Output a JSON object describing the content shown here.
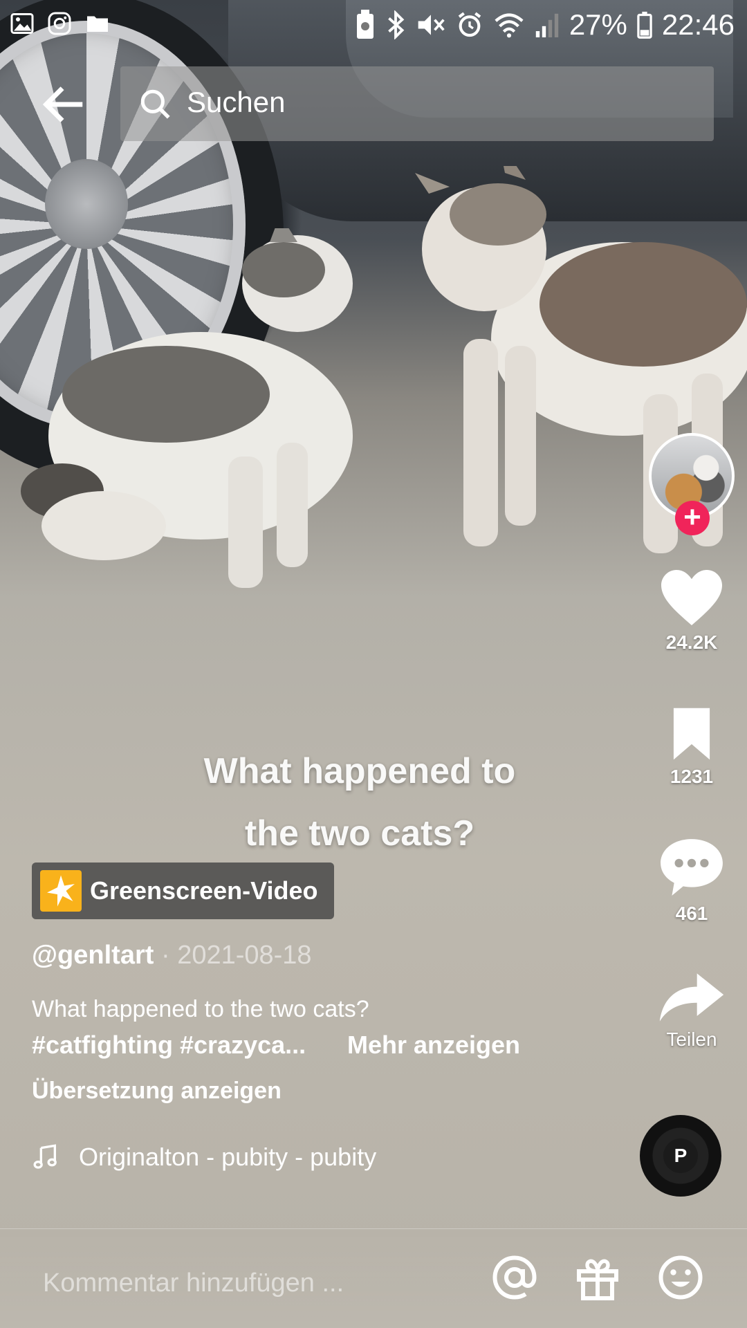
{
  "status_bar": {
    "battery_percent": "27%",
    "time": "22:46",
    "left_icons": [
      "gallery-icon",
      "instagram-icon",
      "folder-icon"
    ],
    "right_icons": [
      "battery-saver-icon",
      "bluetooth-icon",
      "mute-icon",
      "alarm-icon",
      "wifi-icon",
      "signal-icon",
      "battery-icon"
    ]
  },
  "header": {
    "search_placeholder": "Suchen"
  },
  "video": {
    "overlay_caption_line1": "What happened to",
    "overlay_caption_line2": "the two cats?",
    "effect_label": "Greenscreen-Video",
    "author": "@genltart",
    "date": "2021-08-18",
    "description": "What happened to the two cats?",
    "hashtags": "#catfighting #crazyca...",
    "more_label": "Mehr anzeigen",
    "translate_label": "Übersetzung anzeigen",
    "sound": "Originalton - pubity - pubity"
  },
  "actions": {
    "likes": "24.2K",
    "saves": "1231",
    "comments": "461",
    "share_label": "Teilen",
    "follow_symbol": "+"
  },
  "comment_bar": {
    "placeholder": "Kommentar hinzufügen ..."
  },
  "colors": {
    "follow_badge": "#f0245a",
    "effect_icon": "#f9b21b",
    "text": "#ffffff"
  }
}
